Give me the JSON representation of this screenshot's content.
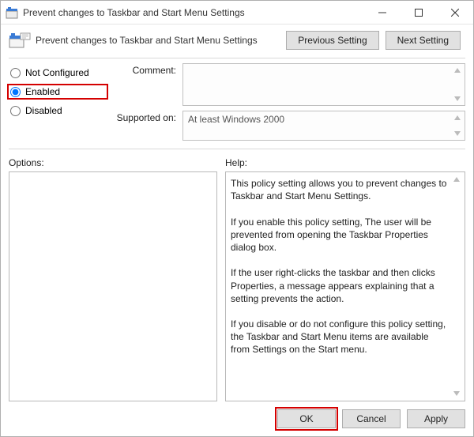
{
  "window": {
    "title": "Prevent changes to Taskbar and Start Menu Settings"
  },
  "subheader": {
    "subtitle": "Prevent changes to Taskbar and Start Menu Settings",
    "prev": "Previous Setting",
    "next": "Next Setting"
  },
  "radios": {
    "not_configured": "Not Configured",
    "enabled": "Enabled",
    "disabled": "Disabled",
    "selected": "enabled"
  },
  "fields": {
    "comment_label": "Comment:",
    "comment_value": "",
    "supported_label": "Supported on:",
    "supported_value": "At least Windows 2000"
  },
  "options": {
    "label": "Options:"
  },
  "help": {
    "label": "Help:",
    "text": "This policy setting allows you to prevent changes to Taskbar and Start Menu Settings.\n\nIf you enable this policy setting, The user will be prevented from opening the Taskbar Properties dialog box.\n\nIf the user right-clicks the taskbar and then clicks Properties, a message appears explaining that a setting prevents the action.\n\nIf you disable or do not configure this policy setting, the Taskbar and Start Menu items are available from Settings on the Start menu."
  },
  "footer": {
    "ok": "OK",
    "cancel": "Cancel",
    "apply": "Apply"
  }
}
